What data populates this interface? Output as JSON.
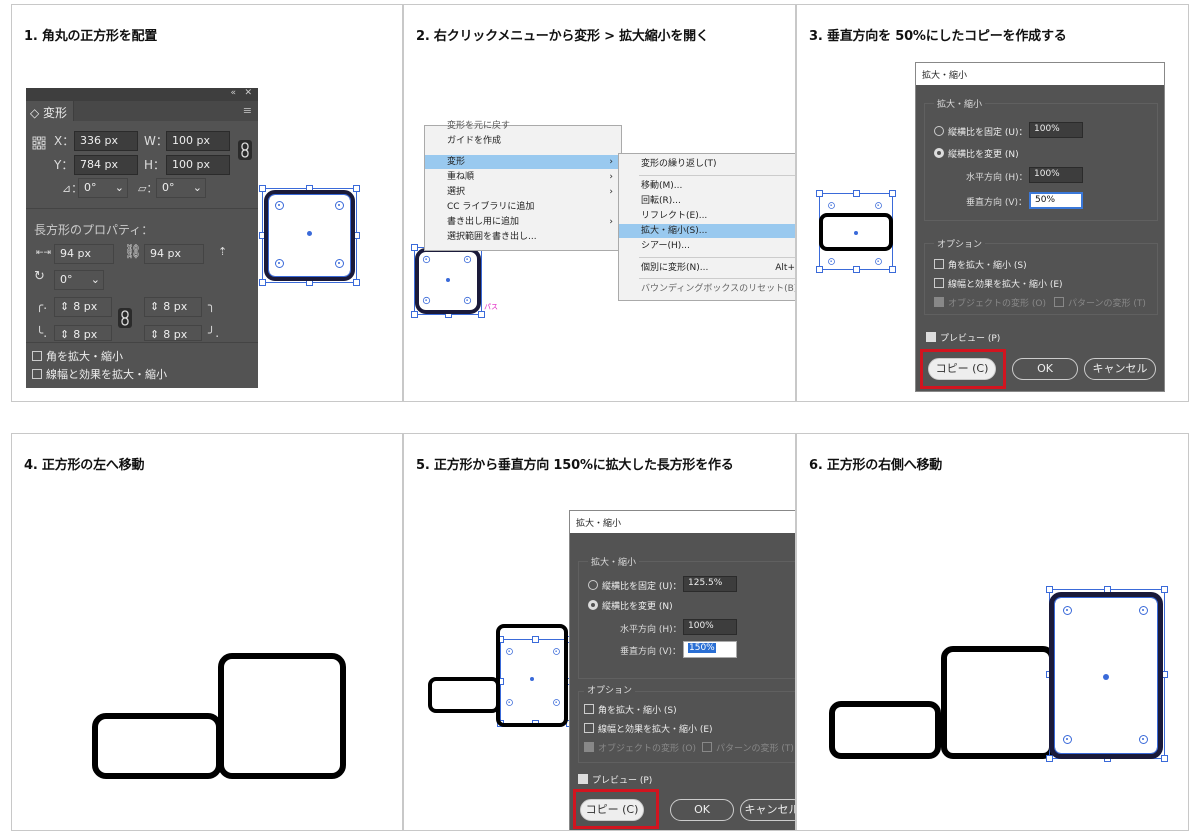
{
  "steps": [
    {
      "caption": "1. 角丸の正方形を配置"
    },
    {
      "caption": "2. 右クリックメニューから変形 > 拡大縮小を開く"
    },
    {
      "caption": "3. 垂直方向を 50%にしたコピーを作成する"
    },
    {
      "caption": "4. 正方形の左へ移動"
    },
    {
      "caption": "5. 正方形から垂直方向 150%に拡大した長方形を作る"
    },
    {
      "caption": "6. 正方形の右側へ移動"
    }
  ],
  "transform_panel": {
    "collapse_glyph": "«",
    "close_glyph": "✕",
    "tab": "◇ 変形",
    "menu_glyph": "≡",
    "x_label": "X：",
    "x_value": "336 px",
    "w_label": "W：",
    "w_value": "100 px",
    "y_label": "Y：",
    "y_value": "784 px",
    "h_label": "H：",
    "h_value": "100 px",
    "angle_label": "⊿：",
    "angle_value": "0°",
    "shear_label": "▱：",
    "shear_value": "0°",
    "rect_props": "長方形のプロパティ：",
    "rect_w": "94 px",
    "rect_h": "94 px",
    "rotate_value": "0°",
    "corner_tl": "8 px",
    "corner_tr": "8 px",
    "corner_bl": "8 px",
    "corner_br": "8 px",
    "scale_corners": "角を拡大・縮小",
    "scale_strokes": "線幅と効果を拡大・縮小"
  },
  "context_menu": {
    "items": [
      "ガイドを作成",
      "変形",
      "重ね順",
      "選択",
      "CC ライブラリに追加",
      "書き出し用に追加",
      "選択範囲を書き出し..."
    ],
    "top_partial": "変形を元に戻す",
    "sub_items": [
      "変形の繰り返し(T)",
      "移動(M)...",
      "回転(R)...",
      "リフレクト(E)...",
      "拡大・縮小(S)...",
      "シアー(H)...",
      "個別に変形(N)...",
      "バウンディングボックスのリセット(B)"
    ],
    "sub_shortcut_partial": "S",
    "sub_shortcut_individual": "Alt+",
    "active_item": "変形",
    "active_sub": "拡大・縮小(S)...",
    "magenta_label": "パス"
  },
  "scale_dialog_3": {
    "title": "拡大・縮小",
    "section": "拡大・縮小",
    "uniform_label": "縦横比を固定 (U)：",
    "uniform_value": "100%",
    "nonuniform_label": "縦横比を変更 (N)",
    "horizontal_label": "水平方向 (H)：",
    "horizontal_value": "100%",
    "vertical_label": "垂直方向 (V)：",
    "vertical_value": "50%",
    "options": "オプション",
    "opt_corners": "角を拡大・縮小 (S)",
    "opt_strokes": "線幅と効果を拡大・縮小 (E)",
    "opt_objects": "オブジェクトの変形 (O)",
    "opt_patterns": "パターンの変形 (T)",
    "preview": "プレビュー (P)",
    "copy": "コピー (C)",
    "ok": "OK",
    "cancel": "キャンセル"
  },
  "scale_dialog_5": {
    "title": "拡大・縮小",
    "section": "拡大・縮小",
    "uniform_label": "縦横比を固定 (U)：",
    "uniform_value": "125.5%",
    "nonuniform_label": "縦横比を変更 (N)",
    "horizontal_label": "水平方向 (H)：",
    "horizontal_value": "100%",
    "vertical_label": "垂直方向 (V)：",
    "vertical_value": "150%",
    "options": "オプション",
    "opt_corners": "角を拡大・縮小 (S)",
    "opt_strokes": "線幅と効果を拡大・縮小 (E)",
    "opt_objects": "オブジェクトの変形 (O)",
    "opt_patterns": "パターンの変形 (T)",
    "preview": "プレビュー (P)",
    "copy": "コピー (C)",
    "ok": "OK",
    "cancel": "キャンセル"
  },
  "colors": {
    "panel": "#535353",
    "field": "#3d3d3d",
    "selection": "#3a6ad9",
    "highlight": "#d2141f",
    "menu_active": "#99c9ef"
  }
}
